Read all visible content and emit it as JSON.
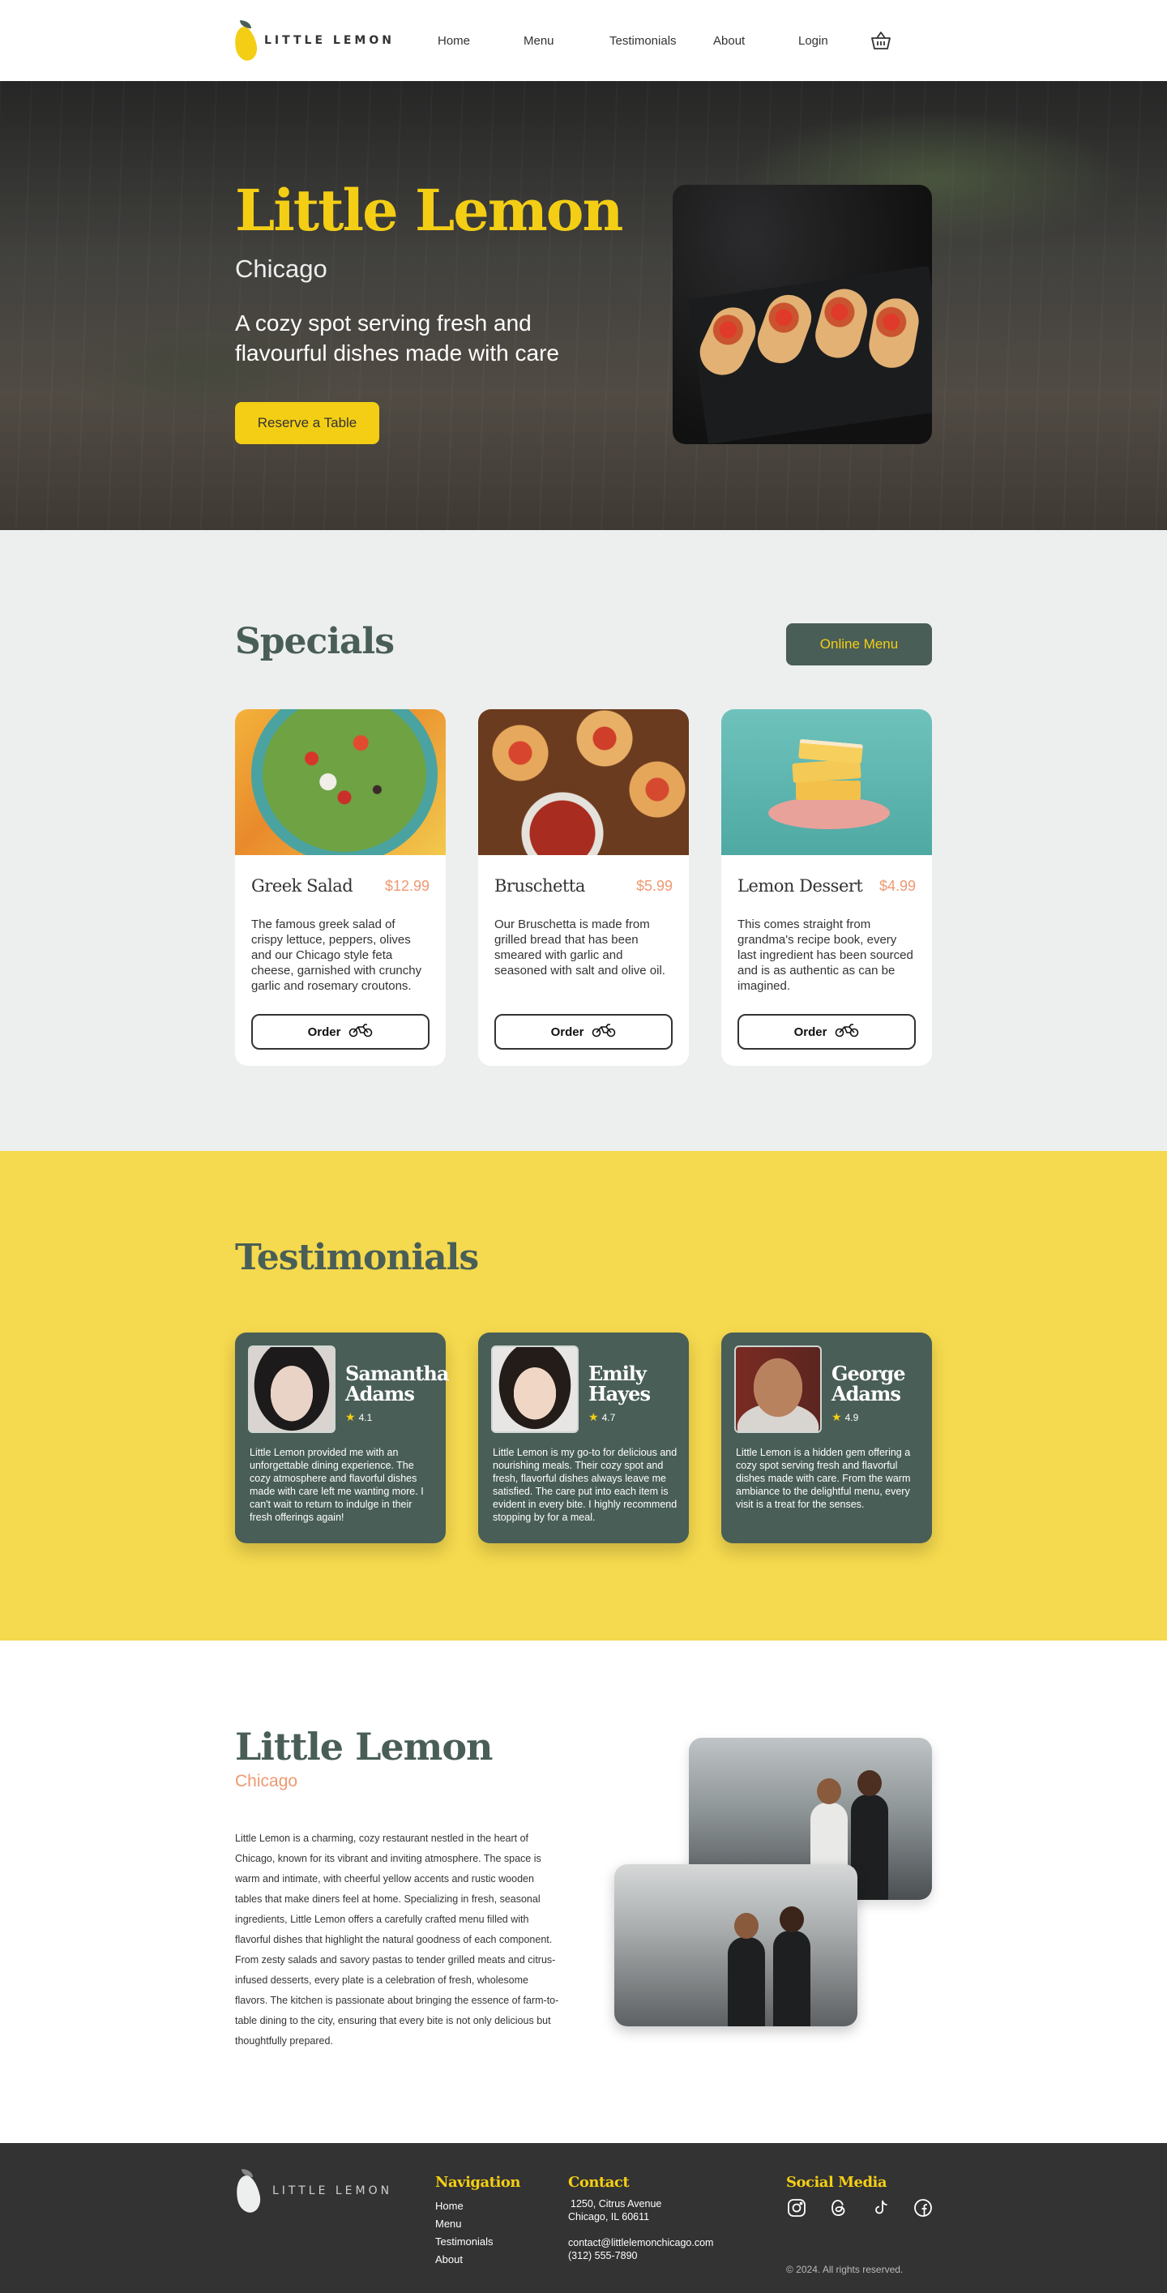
{
  "nav": {
    "brand": "LITTLE LEMON",
    "links": [
      "Home",
      "Menu",
      "Testimonials",
      "About",
      "Login"
    ],
    "cart_icon": "basket-icon"
  },
  "hero": {
    "title": "Little Lemon",
    "subtitle": "Chicago",
    "description": "A cozy spot serving fresh and flavourful dishes made with care",
    "cta": "Reserve a Table"
  },
  "specials": {
    "title": "Specials",
    "online_menu": "Online Menu",
    "items": [
      {
        "name": "Greek Salad",
        "price": "$12.99",
        "description": "The famous greek salad of crispy lettuce, peppers, olives and our Chicago style feta cheese, garnished with crunchy garlic and rosemary croutons.",
        "order": "Order"
      },
      {
        "name": "Bruschetta",
        "price": "$5.99",
        "description": "Our Bruschetta is made from grilled bread that has been smeared with garlic and seasoned with salt and olive oil.",
        "order": "Order"
      },
      {
        "name": "Lemon Dessert",
        "price": "$4.99",
        "description": "This comes straight from grandma's recipe book, every last ingredient has been sourced and is as authentic as can be imagined.",
        "order": "Order"
      }
    ]
  },
  "testimonials": {
    "title": "Testimonials",
    "items": [
      {
        "name": "Samantha Adams",
        "rating": "4.1",
        "quote": "Little Lemon provided me with an unforgettable dining experience. The cozy atmosphere and flavorful dishes made with care left me wanting more. I can't wait to return to indulge in their fresh offerings again!"
      },
      {
        "name": "Emily Hayes",
        "rating": "4.7",
        "quote": "Little Lemon is my go-to for delicious and nourishing meals. Their cozy spot and fresh, flavorful dishes always leave me satisfied. The care put into each item is evident in every bite. I highly recommend stopping by for a meal."
      },
      {
        "name": "George Adams",
        "rating": "4.9",
        "quote": "Little Lemon is a hidden gem offering a cozy spot serving fresh and flavorful dishes made with care. From the warm ambiance to the delightful menu, every visit is a treat for the senses."
      }
    ]
  },
  "about": {
    "title": "Little Lemon",
    "subtitle": "Chicago",
    "text": "Little Lemon is a charming, cozy restaurant nestled in the heart of Chicago, known for its vibrant and inviting atmosphere. The space is warm and intimate, with cheerful yellow accents and rustic wooden tables that make diners feel at home. Specializing in fresh, seasonal ingredients, Little Lemon offers a carefully crafted menu filled with flavorful dishes that highlight the natural goodness of each component. From zesty salads and savory pastas to tender grilled meats and citrus-infused desserts, every plate is a celebration of fresh, wholesome flavors. The kitchen is passionate about bringing the essence of farm-to-table dining to the city, ensuring that every bite is not only delicious but thoughtfully prepared."
  },
  "footer": {
    "brand": "LITTLE LEMON",
    "navigation_title": "Navigation",
    "navigation": [
      "Home",
      "Menu",
      "Testimonials",
      "About"
    ],
    "contact_title": "Contact",
    "address_line1": "1250, Citrus Avenue",
    "address_line2": "Chicago, IL 60611",
    "email": "contact@littlelemonchicago.com",
    "phone": "(312) 555-7890",
    "social_title": "Social Media",
    "social_icons": [
      "instagram-icon",
      "threads-icon",
      "tiktok-icon",
      "facebook-icon"
    ],
    "copyright": "© 2024. All rights reserved."
  },
  "colors": {
    "primary_green": "#495E57",
    "primary_yellow": "#F4CE14",
    "accent_salmon": "#EE9972",
    "highlight_light": "#EDEFEE",
    "dark": "#333333"
  }
}
